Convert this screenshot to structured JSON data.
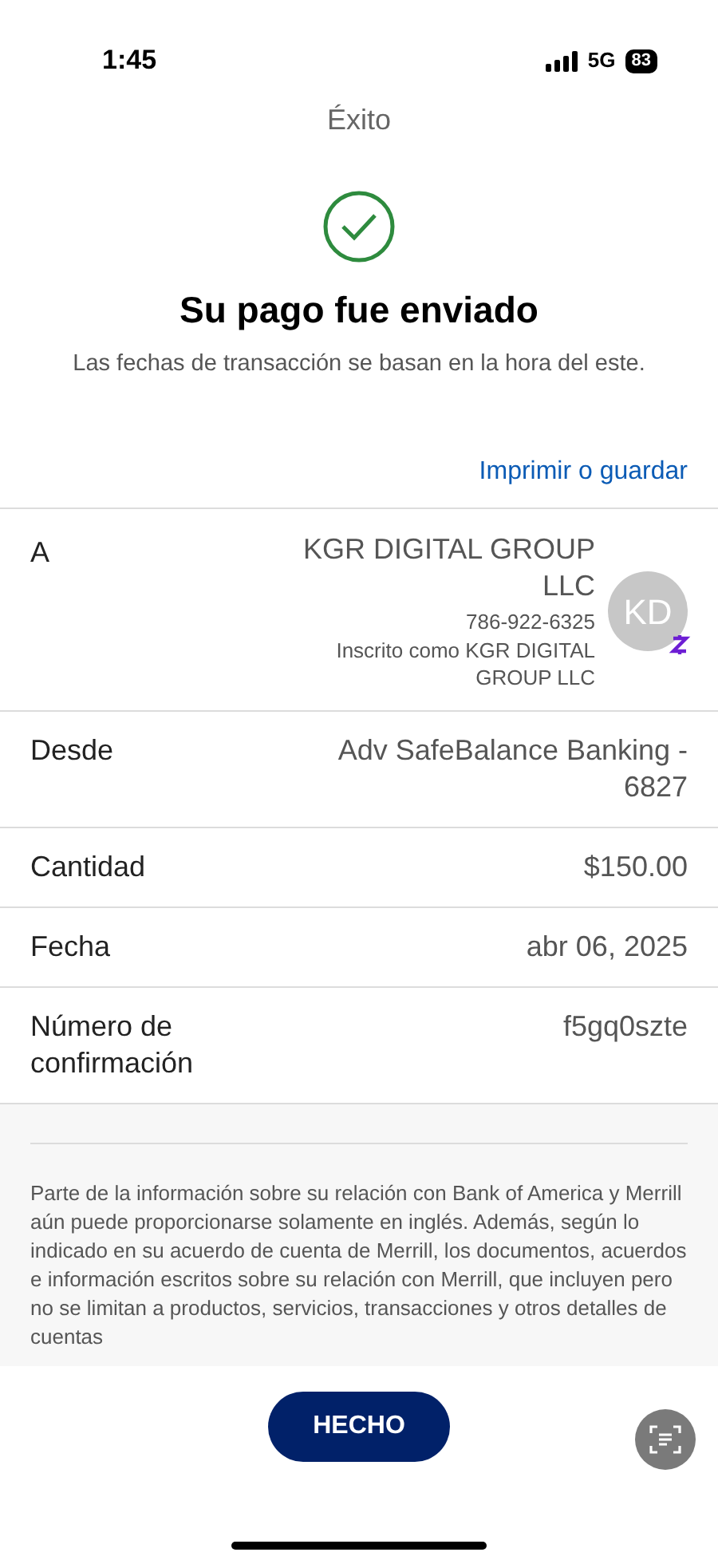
{
  "status_bar": {
    "time": "1:45",
    "network": "5G",
    "battery": "83"
  },
  "header": {
    "title": "Éxito"
  },
  "confirmation": {
    "heading": "Su pago fue enviado",
    "subtitle": "Las fechas de transacción se basan en la hora del este."
  },
  "print_link": "Imprimir o guardar",
  "details": [
    {
      "kind": "recipient",
      "label": "A",
      "value": "KGR DIGITAL GROUP LLC",
      "phone": "786-922-6325",
      "enrolled": "Inscrito como KGR DIGITAL GROUP LLC",
      "avatar": "KD"
    },
    {
      "kind": "plain",
      "label": "Desde",
      "value": "Adv SafeBalance Banking - 6827"
    },
    {
      "kind": "plain",
      "label": "Cantidad",
      "value": "$150.00"
    },
    {
      "kind": "plain",
      "label": "Fecha",
      "value": "abr 06, 2025"
    },
    {
      "kind": "plain",
      "label": "Número de confirmación",
      "value": "f5gq0szte"
    }
  ],
  "disclaimer": "Parte de la información sobre su relación con Bank of America y Merrill aún puede proporcionarse solamente en inglés. Además, según lo indicado en su acuerdo de cuenta de Merrill, los documentos, acuerdos e información escritos sobre su relación con Merrill, que incluyen pero no se limitan a productos, servicios, transacciones y otros detalles de cuentas",
  "done_button": "HECHO"
}
